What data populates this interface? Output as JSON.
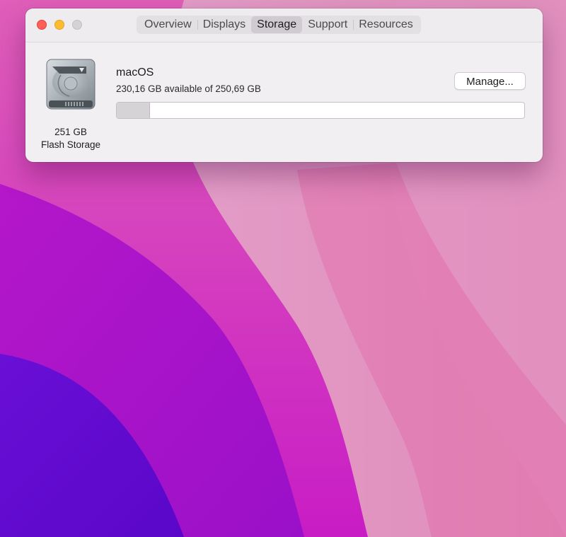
{
  "window": {
    "tabs": [
      {
        "label": "Overview",
        "active": false
      },
      {
        "label": "Displays",
        "active": false
      },
      {
        "label": "Storage",
        "active": true
      },
      {
        "label": "Support",
        "active": false
      },
      {
        "label": "Resources",
        "active": false
      }
    ]
  },
  "storage": {
    "drive_capacity": "251 GB",
    "drive_type": "Flash Storage",
    "volume_name": "macOS",
    "availability": "230,16 GB available of 250,69 GB",
    "used_fraction": 0.082,
    "manage_label": "Manage..."
  },
  "icons": {
    "drive": "hard-drive-icon",
    "close": "close-button",
    "minimize": "minimize-button",
    "zoom": "zoom-button"
  },
  "colors": {
    "close": "#fe5f57",
    "minimize": "#febc2e",
    "zoom_inactive": "#d5d2d6",
    "used_segment": "#d6d3d7"
  }
}
